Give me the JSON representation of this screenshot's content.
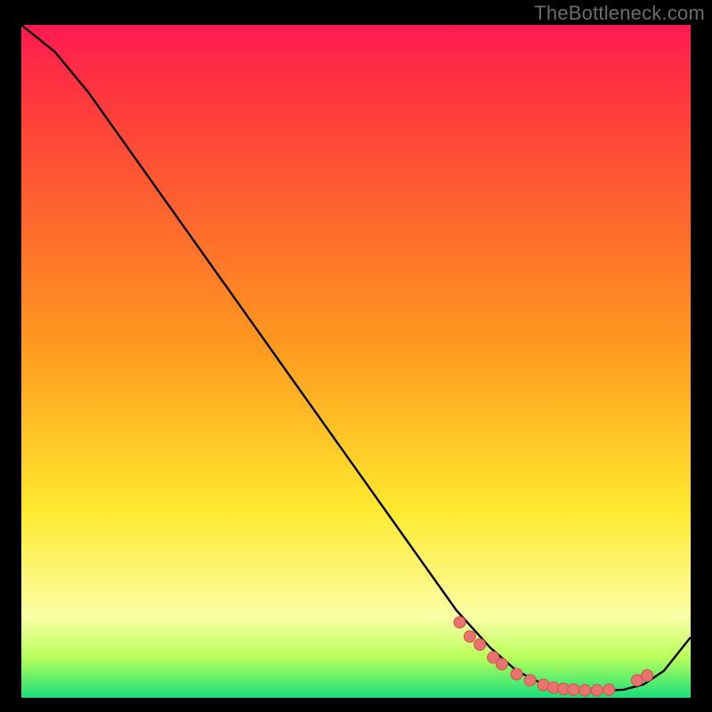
{
  "watermark": "TheBottleneck.com",
  "colors": {
    "bg_black": "#000000",
    "curve": "#000000",
    "marker_fill": "#e9736f",
    "marker_stroke": "#cf524e",
    "grad_top": "#ff1a52",
    "grad_red": "#ff3b3b",
    "grad_orange": "#ff9a1f",
    "grad_yellow": "#ffe92e",
    "grad_pale": "#fbffa6",
    "grad_lime": "#b8ff5a",
    "grad_green": "#18e07a"
  },
  "chart_data": {
    "type": "line",
    "x": [
      0.0,
      0.05,
      0.1,
      0.15,
      0.2,
      0.25,
      0.3,
      0.35,
      0.4,
      0.45,
      0.5,
      0.55,
      0.6,
      0.65,
      0.7,
      0.74,
      0.78,
      0.82,
      0.86,
      0.9,
      0.93,
      0.96,
      1.0
    ],
    "values": [
      1.0,
      0.96,
      0.9,
      0.83,
      0.76,
      0.69,
      0.62,
      0.55,
      0.48,
      0.41,
      0.34,
      0.27,
      0.2,
      0.13,
      0.075,
      0.04,
      0.02,
      0.012,
      0.01,
      0.012,
      0.02,
      0.04,
      0.09
    ],
    "xlim": [
      0,
      1
    ],
    "ylim": [
      0,
      1
    ],
    "markers_x": [
      0.655,
      0.67,
      0.685,
      0.705,
      0.718,
      0.74,
      0.76,
      0.78,
      0.795,
      0.81,
      0.825,
      0.842,
      0.86,
      0.878,
      0.92,
      0.935
    ],
    "markers_y": [
      0.112,
      0.091,
      0.079,
      0.06,
      0.05,
      0.035,
      0.026,
      0.019,
      0.015,
      0.013,
      0.012,
      0.011,
      0.011,
      0.012,
      0.026,
      0.033
    ],
    "title": "",
    "xlabel": "",
    "ylabel": ""
  }
}
